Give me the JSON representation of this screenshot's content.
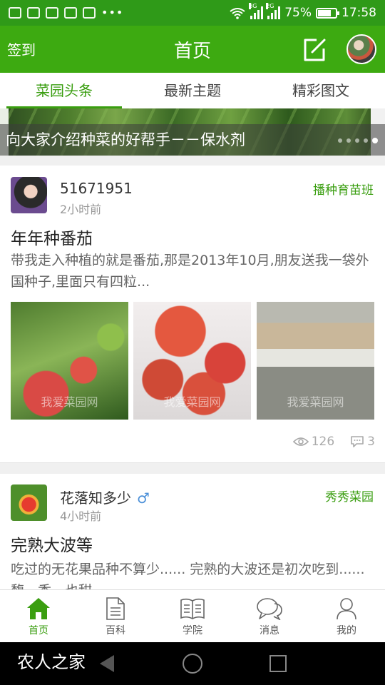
{
  "status_bar": {
    "network_3g_a": "3G",
    "network_3g_b": "2G",
    "battery": "75%",
    "time": "17:58",
    "battery_level": 0.75
  },
  "header": {
    "checkin_label": "签到",
    "title": "首页"
  },
  "tabs": [
    {
      "label": "菜园头条",
      "active": true
    },
    {
      "label": "最新主题",
      "active": false
    },
    {
      "label": "精彩图文",
      "active": false
    }
  ],
  "banner": {
    "title": "向大家介绍种菜的好帮手－－保水剂",
    "slide_count": 5,
    "active_slide": 5
  },
  "posts": [
    {
      "user": "51671951",
      "time": "2小时前",
      "tag": "播种育苗班",
      "title": "年年种番茄",
      "excerpt": "带我走入种植的就是番茄,那是2013年10月,朋友送我一袋外国种子,里面只有四粒...",
      "image_watermark": "我爱菜园网",
      "views": "126",
      "comments": "3"
    },
    {
      "user": "花落知多少",
      "gender_icon": "♂",
      "time": "4小时前",
      "tag": "秀秀菜园",
      "title": "完熟大波等",
      "excerpt": "吃过的无花果品种不算少......   完熟的大波还是初次吃到......馥、香、也甜"
    }
  ],
  "bottom_nav": [
    {
      "label": "首页",
      "icon": "home-icon",
      "active": true
    },
    {
      "label": "百科",
      "icon": "document-icon",
      "active": false
    },
    {
      "label": "学院",
      "icon": "book-icon",
      "active": false
    },
    {
      "label": "消息",
      "icon": "chat-icon",
      "active": false
    },
    {
      "label": "我的",
      "icon": "user-icon",
      "active": false
    }
  ],
  "watermark": "农人之家",
  "colors": {
    "brand_green": "#3daa11",
    "accent_green": "#3a9e10"
  }
}
